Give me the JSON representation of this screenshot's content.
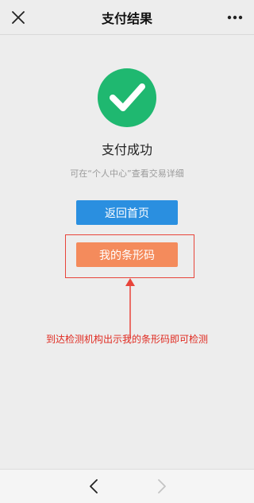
{
  "header": {
    "title": "支付结果",
    "close_icon": "close-icon",
    "more_icon": "more-icon"
  },
  "result": {
    "icon": "check-circle-icon",
    "icon_color": "#1fb870",
    "title": "支付成功",
    "hint": "可在“个人中心”查看交易详细"
  },
  "actions": {
    "home_label": "返回首页",
    "home_color": "#2a8fe0",
    "barcode_label": "我的条形码",
    "barcode_color": "#f48b5c"
  },
  "annotation": {
    "text": "到达检测机构出示我的条形码即可检测",
    "color": "#e02a20"
  },
  "bottom_nav": {
    "back_icon": "chevron-left-icon",
    "forward_icon": "chevron-right-icon"
  }
}
